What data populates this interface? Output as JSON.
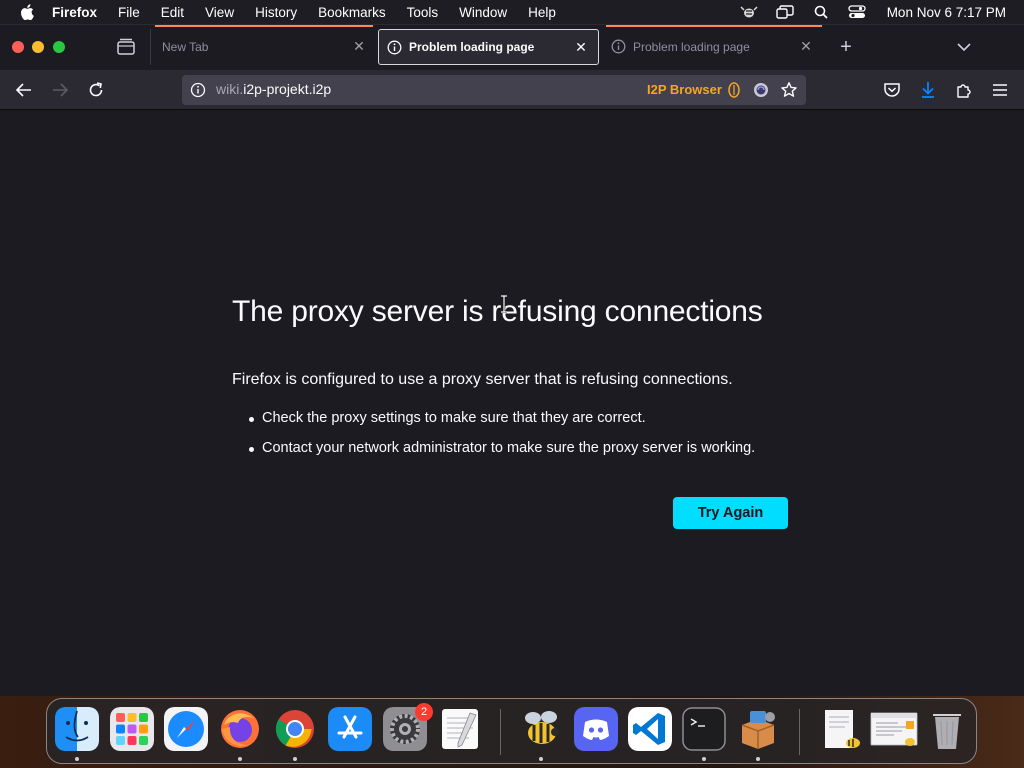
{
  "menubar": {
    "items": [
      "Firefox",
      "File",
      "Edit",
      "View",
      "History",
      "Bookmarks",
      "Tools",
      "Window",
      "Help"
    ],
    "clock": "Mon Nov 6  7:17 PM"
  },
  "tabs": [
    {
      "label": "New Tab"
    },
    {
      "label": "Problem loading page"
    },
    {
      "label": "Problem loading page"
    }
  ],
  "urlbar": {
    "url_dim": "wiki.",
    "url_main": "i2p-projekt.i2p",
    "i2p_label": "I2P Browser"
  },
  "error": {
    "title": "The proxy server is refusing connections",
    "description": "Firefox is configured to use a proxy server that is refusing connections.",
    "suggestions": [
      "Check the proxy settings to make sure that they are correct.",
      "Contact your network administrator to make sure the proxy server is working."
    ],
    "try_again": "Try Again"
  },
  "dock": {
    "apps": [
      "Finder",
      "Launchpad",
      "Safari",
      "Firefox",
      "Chrome",
      "App Store",
      "System Settings",
      "TextEdit",
      "I2P",
      "Discord",
      "Visual Studio Code",
      "Terminal",
      "Installer",
      "Document",
      "Browser window",
      "Trash"
    ],
    "settings_badge": "2"
  },
  "colors": {
    "accent_button": "#00ddff",
    "content_bg": "#1c1b22",
    "i2p_orange": "#f5a623"
  }
}
